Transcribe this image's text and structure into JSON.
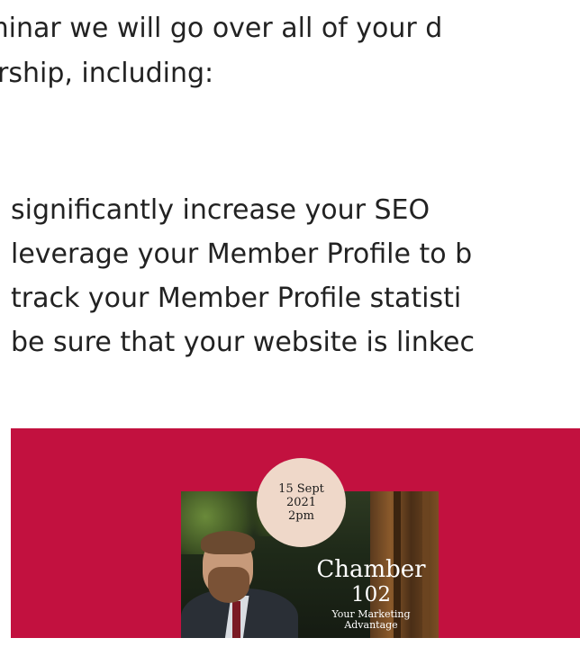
{
  "article": {
    "intro_line1": "eminar we will go over all of your d",
    "intro_line2": "rship, including:",
    "bullets": [
      "significantly increase your SEO",
      "leverage your Member Profile to b",
      "track your Member Profile statisti",
      "be sure that your website is linkec"
    ]
  },
  "banner": {
    "background_color": "#c2113f",
    "date_line1": "15 Sept",
    "date_line2": "2021",
    "date_line3": "2pm",
    "title_line1": "Chamber",
    "title_line2": "102",
    "subtitle_line1": "Your Marketing",
    "subtitle_line2": "Advantage"
  }
}
